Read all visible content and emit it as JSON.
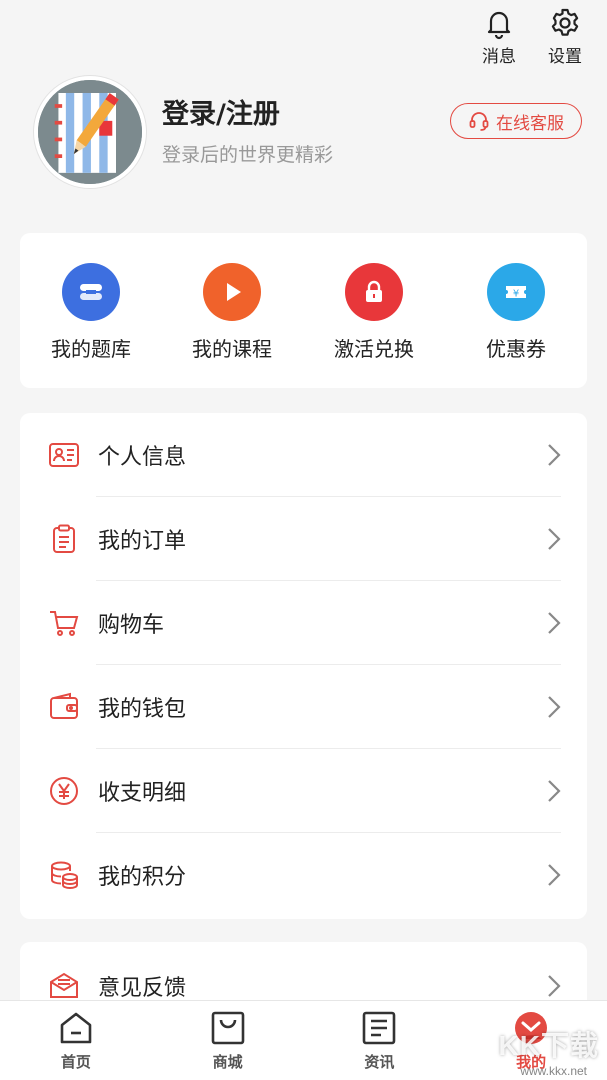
{
  "header": {
    "messages_label": "消息",
    "settings_label": "设置"
  },
  "profile": {
    "title": "登录/注册",
    "subtitle": "登录后的世界更精彩",
    "service_label": "在线客服"
  },
  "quick_actions": [
    {
      "label": "我的题库",
      "icon": "question-bank-icon",
      "color": "#3d6fe0"
    },
    {
      "label": "我的课程",
      "icon": "play-icon",
      "color": "#f0622b"
    },
    {
      "label": "激活兑换",
      "icon": "lock-icon",
      "color": "#e8373a"
    },
    {
      "label": "优惠券",
      "icon": "coupon-icon",
      "color": "#2ba8e8"
    }
  ],
  "menu": [
    {
      "label": "个人信息",
      "icon": "id-card-icon"
    },
    {
      "label": "我的订单",
      "icon": "clipboard-icon"
    },
    {
      "label": "购物车",
      "icon": "cart-icon"
    },
    {
      "label": "我的钱包",
      "icon": "wallet-icon"
    },
    {
      "label": "收支明细",
      "icon": "yuan-icon"
    },
    {
      "label": "我的积分",
      "icon": "coins-icon"
    }
  ],
  "feedback": {
    "label": "意见反馈",
    "icon": "feedback-icon"
  },
  "bottom_nav": [
    {
      "label": "首页",
      "icon": "home-icon",
      "active": false
    },
    {
      "label": "商城",
      "icon": "shop-bag-icon",
      "active": false
    },
    {
      "label": "资讯",
      "icon": "news-icon",
      "active": false
    },
    {
      "label": "我的",
      "icon": "profile-icon",
      "active": true
    }
  ],
  "watermark": {
    "text": "KK下载",
    "url": "www.kkx.net"
  },
  "colors": {
    "accent": "#e34a42",
    "background": "#f5f5f5",
    "card": "#ffffff"
  }
}
